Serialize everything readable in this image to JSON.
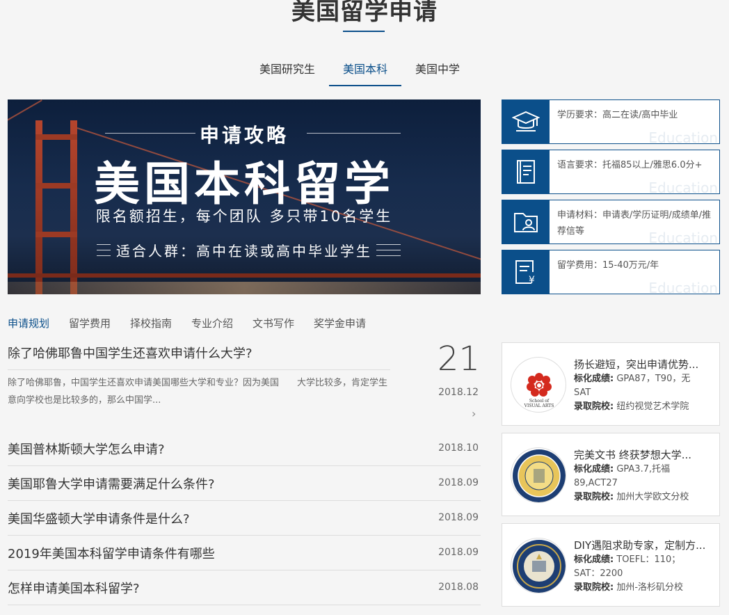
{
  "page": {
    "title": "美国留学申请"
  },
  "program_tabs": [
    {
      "label": "美国研究生",
      "active": false
    },
    {
      "label": "美国本科",
      "active": true
    },
    {
      "label": "美国中学",
      "active": false
    }
  ],
  "banner": {
    "subtitle": "申请攻略",
    "headline": "美国本科留学",
    "tagline1": "限名额招生，每个团队   多只带10名学生",
    "tagline2": "适合人群：高中在读或高中毕业学生"
  },
  "requirements": [
    {
      "icon": "graduation-cap-icon",
      "text": "学历要求：高二在读/高中毕业",
      "watermark": "Education"
    },
    {
      "icon": "book-icon",
      "text": "语言要求：托福85以上/雅思6.0分+",
      "watermark": "Education"
    },
    {
      "icon": "document-folder-icon",
      "text": "申请材料：申请表/学历证明/成绩单/推荐信等",
      "watermark": "Education"
    },
    {
      "icon": "fee-invoice-icon",
      "text": "留学费用：15-40万元/年",
      "watermark": "Education"
    }
  ],
  "news_tabs": [
    {
      "label": "申请规划",
      "active": true
    },
    {
      "label": "留学费用",
      "active": false
    },
    {
      "label": "择校指南",
      "active": false
    },
    {
      "label": "专业介绍",
      "active": false
    },
    {
      "label": "文书写作",
      "active": false
    },
    {
      "label": "奖学金申请",
      "active": false
    }
  ],
  "featured": {
    "title": "除了哈佛耶鲁中国学生还喜欢申请什么大学?",
    "summary": "除了哈佛耶鲁，中国学生还喜欢申请美国哪些大学和专业？因为美国　　大学比较多，肯定学生意向学校也是比较多的，那么中国学...",
    "day": "21",
    "month": "2018.12",
    "arrow": "›"
  },
  "news": [
    {
      "title": "美国普林斯顿大学怎么申请?",
      "date": "2018.10"
    },
    {
      "title": "美国耶鲁大学申请需要满足什么条件?",
      "date": "2018.09"
    },
    {
      "title": "美国华盛顿大学申请条件是什么?",
      "date": "2018.09"
    },
    {
      "title": "2019年美国本科留学申请条件有哪些",
      "date": "2018.09"
    },
    {
      "title": "怎样申请美国本科留学?",
      "date": "2018.08"
    }
  ],
  "cases": [
    {
      "logo": "school-of-visual-arts-logo",
      "logo_text": [
        "School of",
        "VISUAL ARTS"
      ],
      "title": "扬长避短，突出申请优势...",
      "score_label": "标化成绩:",
      "score": " GPA87，T90，无SAT",
      "school_label": "录取院校:",
      "school": " 纽约视觉艺术学院"
    },
    {
      "logo": "uc-seal-gold-logo",
      "title": "完美文书 终获梦想大学...",
      "score_label": "标化成绩:",
      "score": "  GPA3.7,托福89,ACT27",
      "school_label": "录取院校:",
      "school": " 加州大学欧文分校"
    },
    {
      "logo": "uc-seal-blue-logo",
      "title": "DIY遇阻求助专家，定制方...",
      "score_label": "标化成绩:",
      "score": " TOEFL：110；SAT：2200",
      "school_label": "录取院校:",
      "school": " 加州-洛杉矶分校"
    }
  ],
  "colors": {
    "accent": "#0b4f8a",
    "background": "#f5f5f5",
    "banner_dark": "#0d1f3c"
  }
}
